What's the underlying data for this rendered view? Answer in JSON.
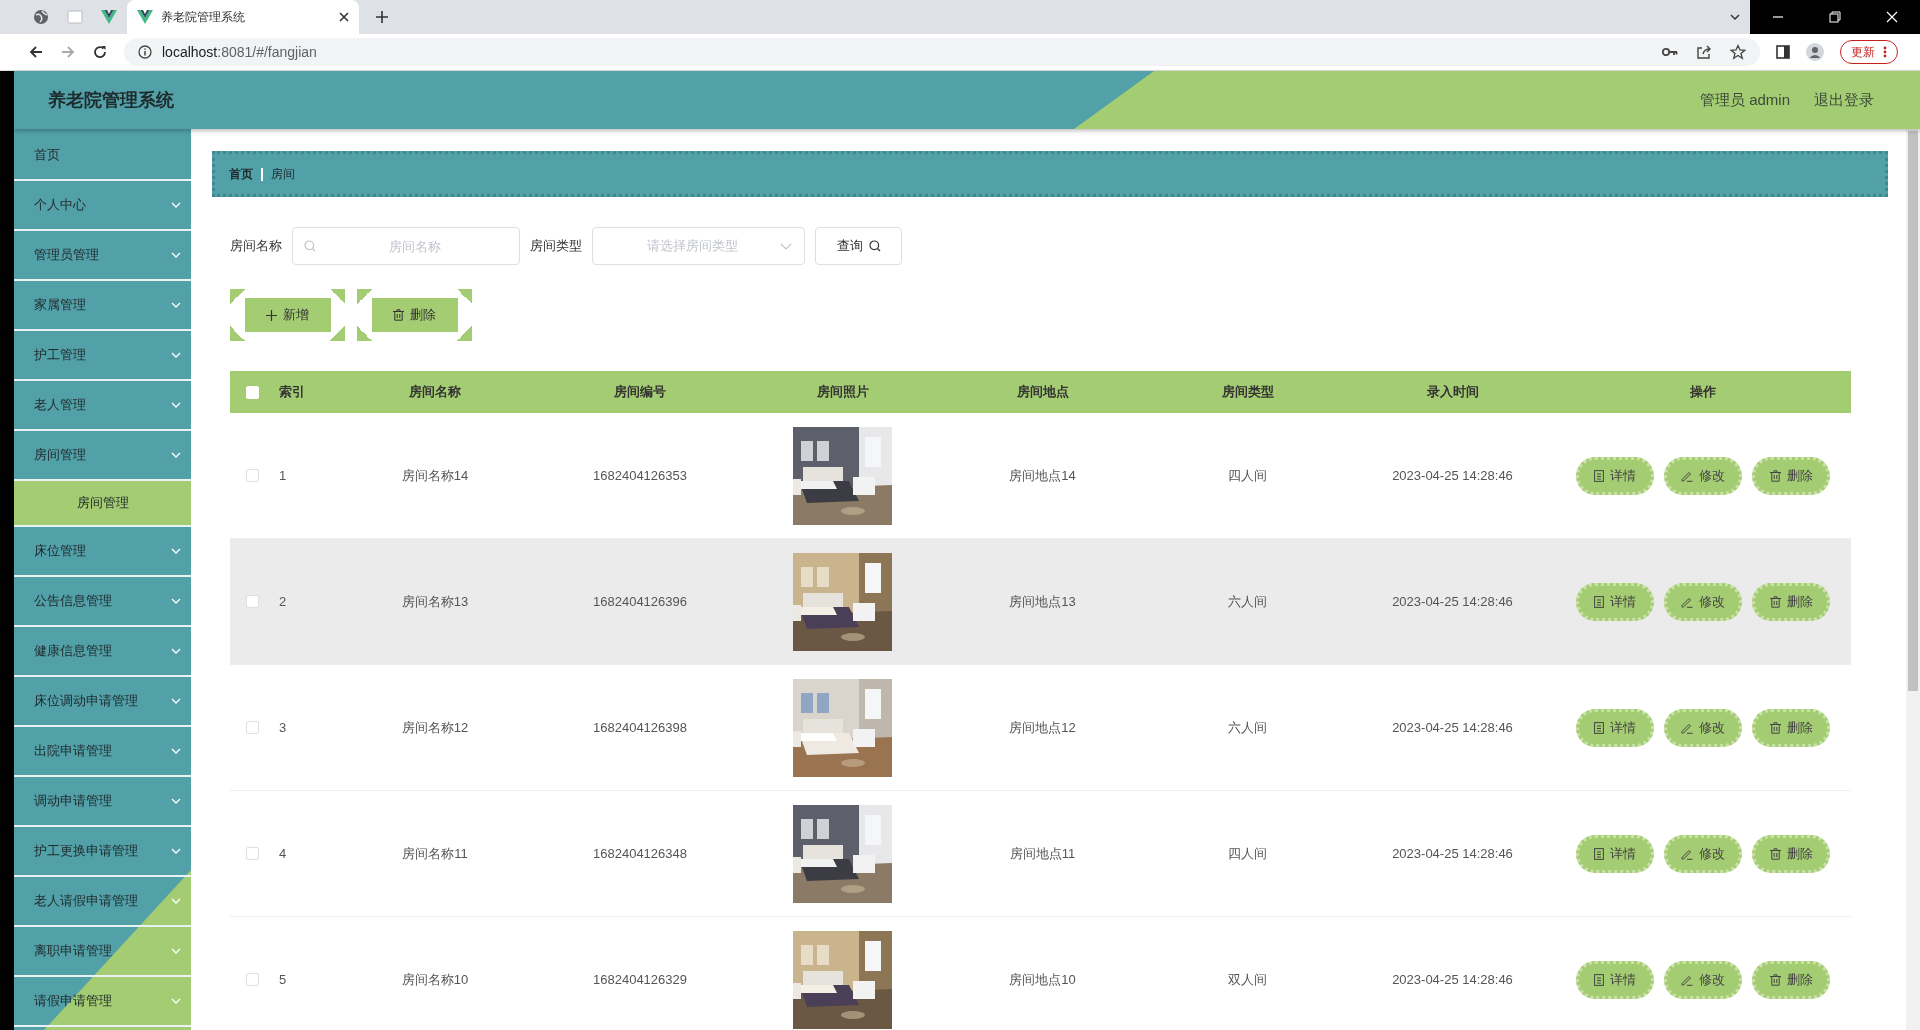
{
  "browser": {
    "tab_title": "养老院管理系统",
    "url_host": "localhost",
    "url_rest": ":8081/#/fangjian",
    "update_button": "更新"
  },
  "app": {
    "title": "养老院管理系统",
    "user": "管理员 admin",
    "logout": "退出登录"
  },
  "sidebar": {
    "items": [
      {
        "label": "首页",
        "kind": "link",
        "selected": false
      },
      {
        "label": "个人中心",
        "kind": "menu",
        "selected": false
      },
      {
        "label": "管理员管理",
        "kind": "menu",
        "selected": false
      },
      {
        "label": "家属管理",
        "kind": "menu",
        "selected": false
      },
      {
        "label": "护工管理",
        "kind": "menu",
        "selected": false
      },
      {
        "label": "老人管理",
        "kind": "menu",
        "selected": false
      },
      {
        "label": "房间管理",
        "kind": "menu",
        "selected": false,
        "children": [
          {
            "label": "房间管理",
            "selected": true
          }
        ]
      },
      {
        "label": "床位管理",
        "kind": "menu",
        "selected": false
      },
      {
        "label": "公告信息管理",
        "kind": "menu",
        "selected": false
      },
      {
        "label": "健康信息管理",
        "kind": "menu",
        "selected": false
      },
      {
        "label": "床位调动申请管理",
        "kind": "menu",
        "selected": false
      },
      {
        "label": "出院申请管理",
        "kind": "menu",
        "selected": false
      },
      {
        "label": "调动申请管理",
        "kind": "menu",
        "selected": false
      },
      {
        "label": "护工更换申请管理",
        "kind": "menu",
        "selected": false
      },
      {
        "label": "老人请假申请管理",
        "kind": "menu",
        "selected": false
      },
      {
        "label": "离职申请管理",
        "kind": "menu",
        "selected": false
      },
      {
        "label": "请假申请管理",
        "kind": "menu",
        "selected": false
      }
    ]
  },
  "breadcrumb": [
    "首页",
    "房间"
  ],
  "filters": {
    "name_label": "房间名称",
    "name_placeholder": "房间名称",
    "type_label": "房间类型",
    "type_placeholder": "请选择房间类型",
    "query_button": "查询"
  },
  "actions": [
    {
      "kind": "add",
      "label": "新增"
    },
    {
      "kind": "delete",
      "label": "删除"
    }
  ],
  "table": {
    "select_all": {
      "checked": false
    },
    "columns": [
      "索引",
      "房间名称",
      "房间编号",
      "房间照片",
      "房间地点",
      "房间类型",
      "录入时间",
      "操作"
    ],
    "rows": [
      {
        "checked": false,
        "hovered": false,
        "index": "1",
        "name": "房间名称14",
        "number": "1682404126353",
        "location": "房间地点14",
        "type": "四人间",
        "time": "2023-04-25 14:28:46",
        "buttons": [
          {
            "kind": "detail",
            "label": "详情"
          },
          {
            "kind": "edit",
            "label": "修改"
          },
          {
            "kind": "delete",
            "label": "删除"
          }
        ]
      },
      {
        "checked": false,
        "hovered": true,
        "index": "2",
        "name": "房间名称13",
        "number": "1682404126396",
        "location": "房间地点13",
        "type": "六人间",
        "time": "2023-04-25 14:28:46",
        "buttons": [
          {
            "kind": "detail",
            "label": "详情"
          },
          {
            "kind": "edit",
            "label": "修改"
          },
          {
            "kind": "delete",
            "label": "删除"
          }
        ]
      },
      {
        "checked": false,
        "hovered": false,
        "index": "3",
        "name": "房间名称12",
        "number": "1682404126398",
        "location": "房间地点12",
        "type": "六人间",
        "time": "2023-04-25 14:28:46",
        "buttons": [
          {
            "kind": "detail",
            "label": "详情"
          },
          {
            "kind": "edit",
            "label": "修改"
          },
          {
            "kind": "delete",
            "label": "删除"
          }
        ]
      },
      {
        "checked": false,
        "hovered": false,
        "index": "4",
        "name": "房间名称11",
        "number": "1682404126348",
        "location": "房间地点11",
        "type": "四人间",
        "time": "2023-04-25 14:28:46",
        "buttons": [
          {
            "kind": "detail",
            "label": "详情"
          },
          {
            "kind": "edit",
            "label": "修改"
          },
          {
            "kind": "delete",
            "label": "删除"
          }
        ]
      },
      {
        "checked": false,
        "hovered": false,
        "index": "5",
        "name": "房间名称10",
        "number": "1682404126329",
        "location": "房间地点10",
        "type": "双人间",
        "time": "2023-04-25 14:28:46",
        "buttons": [
          {
            "kind": "detail",
            "label": "详情"
          },
          {
            "kind": "edit",
            "label": "修改"
          },
          {
            "kind": "delete",
            "label": "删除"
          }
        ]
      }
    ]
  }
}
